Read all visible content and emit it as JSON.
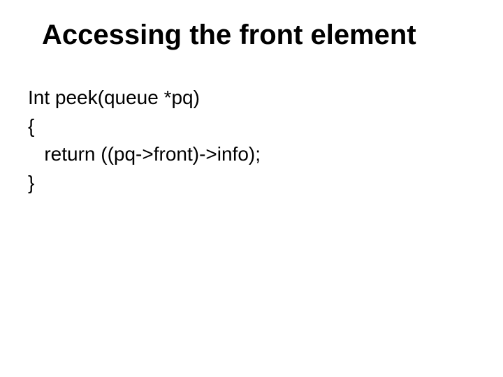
{
  "slide": {
    "title": "Accessing the front element",
    "code": {
      "line1": "Int peek(queue *pq)",
      "line2": "{",
      "line3": "   return ((pq->front)->info);",
      "line4": "}"
    }
  }
}
